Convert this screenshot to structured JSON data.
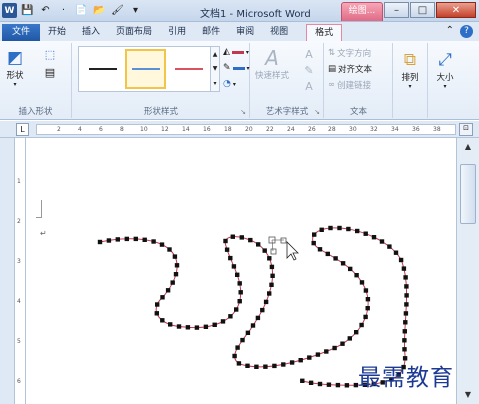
{
  "window": {
    "title": "文档1 - Microsoft Word",
    "context_tab_title": "绘图...",
    "minimize": "–",
    "maximize": "□",
    "close": "✕"
  },
  "quick_access": [
    "W",
    "💾",
    "↶",
    "·",
    "📄",
    "📂",
    "🖌",
    "▾"
  ],
  "tabs": {
    "file": "文件",
    "items": [
      "开始",
      "插入",
      "页面布局",
      "引用",
      "邮件",
      "审阅",
      "视图"
    ],
    "active": "格式",
    "help": "?"
  },
  "ribbon": {
    "insert_shapes": {
      "shapes_label": "形状",
      "group_label": "插入形状"
    },
    "shape_styles": {
      "group_label": "形状样式",
      "expand": "↘"
    },
    "art_styles": {
      "quick_styles": "快速样式",
      "group_label": "艺术字样式",
      "expand": "↘"
    },
    "text": {
      "direction": "文字方向",
      "align": "对齐文本",
      "create_link": "创建链接",
      "group_label": "文本"
    },
    "arrange": "排列",
    "size": "大小"
  },
  "ruler": {
    "numbers": [
      "2",
      "4",
      "6",
      "8",
      "10",
      "12",
      "14",
      "16",
      "18",
      "20",
      "22",
      "24",
      "26",
      "28",
      "30",
      "32",
      "34",
      "36",
      "38"
    ],
    "tab_selector": "L"
  },
  "vruler": {
    "numbers": [
      "1",
      "2",
      "3",
      "4",
      "5",
      "6",
      "7"
    ]
  },
  "document": {
    "paragraph_mark": "↵"
  },
  "colors": {
    "shape_line": "#c0394f",
    "style1": "#222222",
    "style2": "#5b8fd6",
    "style3": "#d9535f"
  },
  "watermark": "最需教育"
}
